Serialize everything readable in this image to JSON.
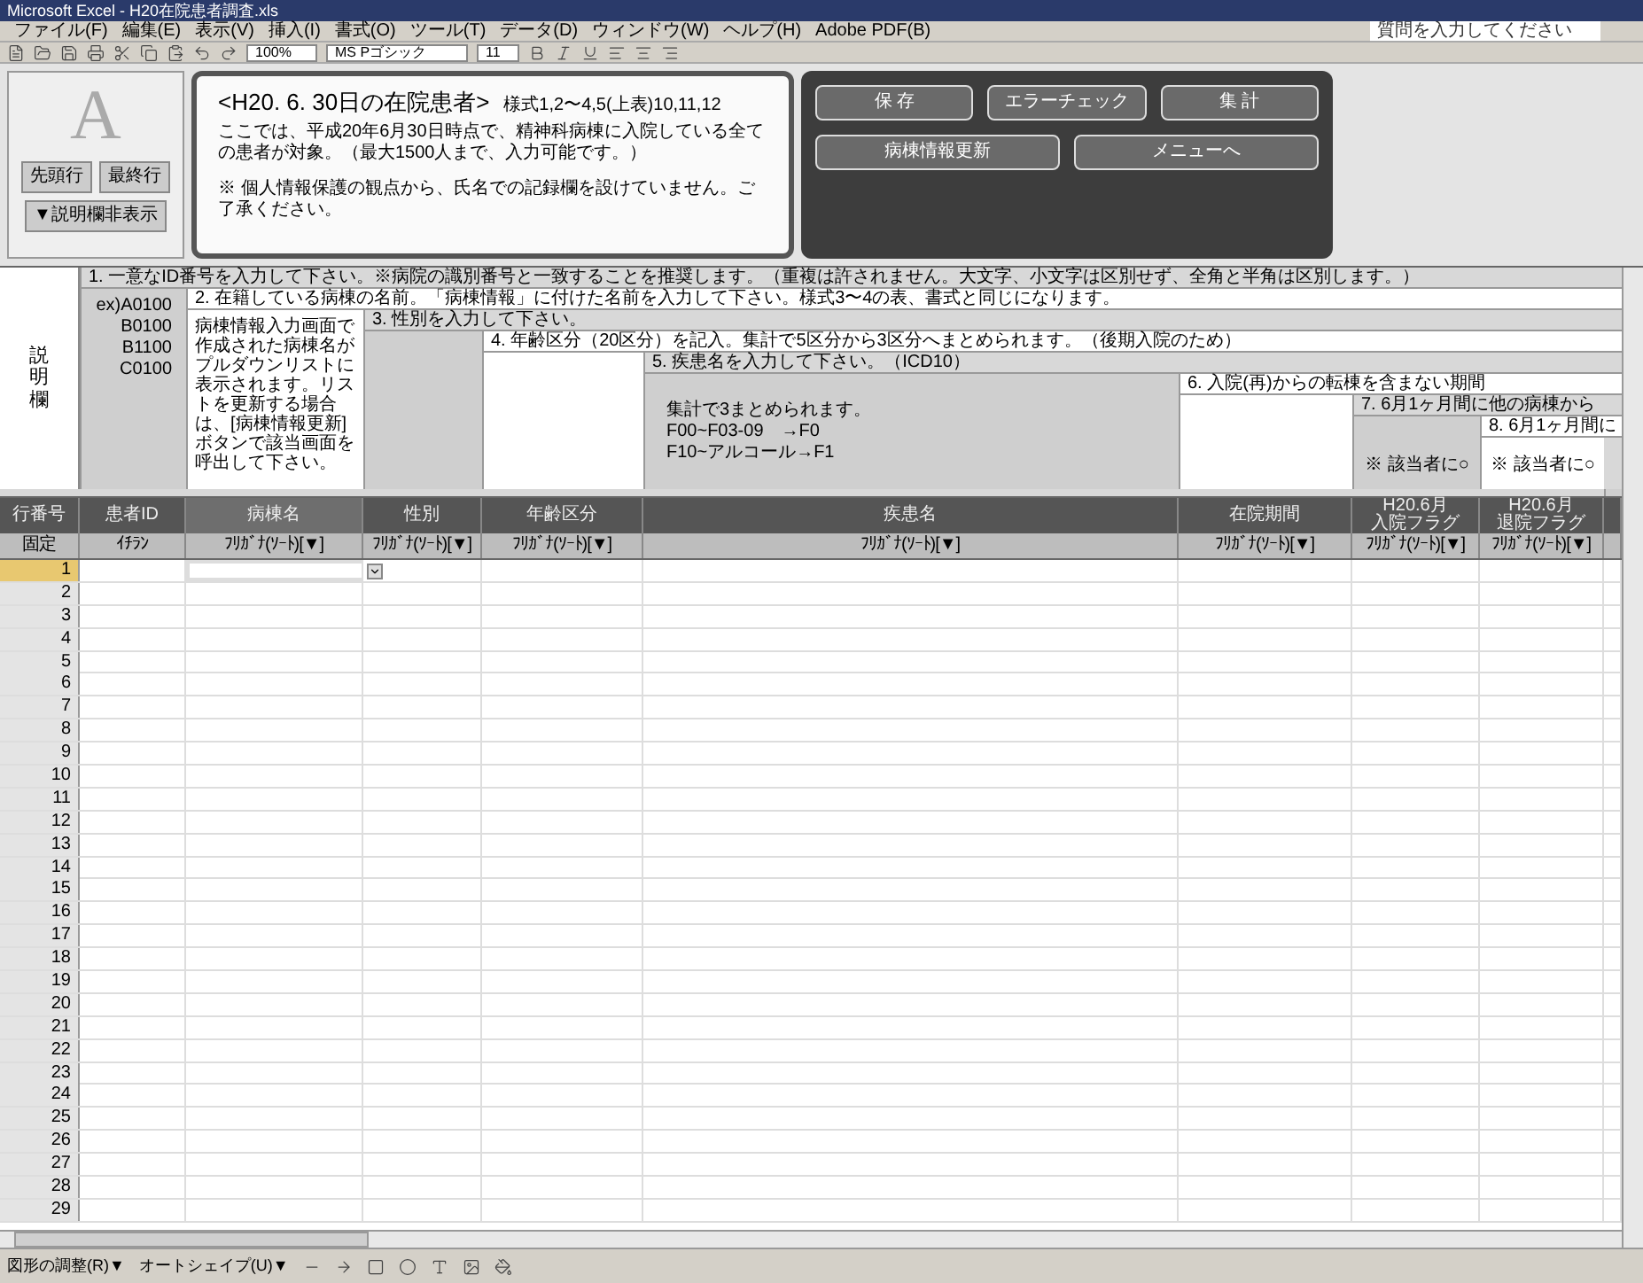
{
  "window": {
    "title": "Microsoft Excel - H20在院患者調査.xls"
  },
  "menu": [
    "ファイル(F)",
    "編集(E)",
    "表示(V)",
    "挿入(I)",
    "書式(O)",
    "ツール(T)",
    "データ(D)",
    "ウィンドウ(W)",
    "ヘルプ(H)",
    "Adobe PDF(B)"
  ],
  "help_search": {
    "placeholder": "質問を入力してください"
  },
  "toolbar": {
    "zoom": "100%",
    "font": "MS Pゴシック",
    "size": "11"
  },
  "logo": {
    "letter": "A"
  },
  "nav_buttons": [
    "先頭行",
    "最終行",
    "▼説明欄非表示"
  ],
  "info": {
    "title": "<H20. 6. 30日の在院患者>",
    "note": "様式1,2〜4,5(上表)10,11,12",
    "body": "ここでは、平成20年6月30日時点で、精神科病棟に入院している全ての患者が対象。（最大1500人まで、入力可能です。）",
    "warning": "※ 個人情報保護の観点から、氏名での記録欄を設けていません。ご了承ください。"
  },
  "action_buttons": [
    [
      "保 存",
      "エラーチェック",
      "集 計"
    ],
    [
      "病棟情報更新",
      "メニューへ"
    ]
  ],
  "description": {
    "label": "説明欄",
    "instructions": [
      {
        "text": "1. 一意なID番号を入力して下さい。※病院の識別番号と一致することを推奨します。（重複は許されません。大文字、小文字は区別せず、全角と半角は区別します。）",
        "shaded": true
      },
      {
        "text": "2. 在籍している病棟の名前。「病棟情報」に付けた名前を入力して下さい。様式3〜4の表、書式と同じになります。",
        "shaded": false
      },
      {
        "text": "3. 性別を入力して下さい。",
        "shaded": true
      },
      {
        "text": "4. 年齢区分（20区分）を記入。集計で5区分から3区分へまとめられます。（後期入院のため）",
        "shaded": false
      },
      {
        "text": "5. 疾患名を入力して下さい。（ICD10）",
        "shaded": true
      },
      {
        "text": "6. 入院(再)からの転棟を含まない期間",
        "shaded": false
      },
      {
        "text": "7. 6月1ヶ月間に他の病棟から",
        "shaded": true
      },
      {
        "text": "8. 6月1ヶ月間に",
        "shaded": false
      }
    ],
    "columns": [
      {
        "lines": [
          "ex)A0100",
          "B0100",
          "B1100",
          "C0100"
        ],
        "shaded": true,
        "kind": "right"
      },
      {
        "lines": [
          "病棟情報入力画面で作成された病棟名がプルダウンリストに表示されます。リストを更新する場合は、[病棟情報更新]ボタンで該当画面を呼出して下さい。"
        ],
        "shaded": false,
        "kind": "center"
      },
      {
        "shaded": true,
        "kind": "center"
      },
      {
        "shaded": false,
        "kind": "center"
      },
      {
        "lines": [
          "集計で3まとめられます。",
          "F00~F03-09　→F0",
          "F10~アルコール→F1"
        ],
        "shaded": true,
        "kind": "middle"
      },
      {
        "shaded": false,
        "kind": "center"
      },
      {
        "lines": [
          "※ 該当者に○"
        ],
        "shaded": true,
        "kind": "bottom"
      },
      {
        "lines": [
          "※ 該当者に○"
        ],
        "shaded": false,
        "kind": "bottom"
      },
      {
        "shaded": true,
        "kind": "center"
      }
    ]
  },
  "table": {
    "columns": [
      {
        "lines": [
          "行番号"
        ],
        "filter": "固定",
        "selected": false
      },
      {
        "lines": [
          "患者ID"
        ],
        "filter": "ｲﾁﾗﾝ",
        "selected": false
      },
      {
        "lines": [
          "病棟名"
        ],
        "filter": "ﾌﾘｶﾞﾅ(ｿｰﾄ)[▼]",
        "selected": true
      },
      {
        "lines": [
          "性別"
        ],
        "filter": "ﾌﾘｶﾞﾅ(ｿｰﾄ)[▼]",
        "selected": false
      },
      {
        "lines": [
          "年齢区分"
        ],
        "filter": "ﾌﾘｶﾞﾅ(ｿｰﾄ)[▼]",
        "selected": false
      },
      {
        "lines": [
          "疾患名"
        ],
        "filter": "ﾌﾘｶﾞﾅ(ｿｰﾄ)[▼]",
        "selected": false
      },
      {
        "lines": [
          "在院期間"
        ],
        "filter": "ﾌﾘｶﾞﾅ(ｿｰﾄ)[▼]",
        "selected": false
      },
      {
        "lines": [
          "H20.6月",
          "入院フラグ"
        ],
        "filter": "ﾌﾘｶﾞﾅ(ｿｰﾄ)[▼]",
        "selected": false
      },
      {
        "lines": [
          "H20.6月",
          "退院フラグ"
        ],
        "filter": "ﾌﾘｶﾞﾅ(ｿｰﾄ)[▼]",
        "selected": false
      },
      {
        "selected": false
      }
    ],
    "rows": [
      {
        "number": "1",
        "selected": true
      },
      {
        "number": "2",
        "selected": false
      },
      {
        "number": "3",
        "selected": false
      },
      {
        "number": "4",
        "selected": false
      },
      {
        "number": "5",
        "selected": false
      },
      {
        "number": "6",
        "selected": false
      },
      {
        "number": "7",
        "selected": false
      },
      {
        "number": "8",
        "selected": false
      },
      {
        "number": "9",
        "selected": false
      },
      {
        "number": "10",
        "selected": false
      },
      {
        "number": "11",
        "selected": false
      },
      {
        "number": "12",
        "selected": false
      },
      {
        "number": "13",
        "selected": false
      },
      {
        "number": "14",
        "selected": false
      },
      {
        "number": "15",
        "selected": false
      },
      {
        "number": "16",
        "selected": false
      },
      {
        "number": "17",
        "selected": false
      },
      {
        "number": "18",
        "selected": false
      },
      {
        "number": "19",
        "selected": false
      },
      {
        "number": "20",
        "selected": false
      },
      {
        "number": "21",
        "selected": false
      },
      {
        "number": "22",
        "selected": false
      },
      {
        "number": "23",
        "selected": false
      },
      {
        "number": "24",
        "selected": false
      },
      {
        "number": "25",
        "selected": false
      },
      {
        "number": "26",
        "selected": false
      },
      {
        "number": "27",
        "selected": false
      },
      {
        "number": "28",
        "selected": false
      },
      {
        "number": "29",
        "selected": false
      }
    ]
  },
  "drawing_toolbar": {
    "draw": "図形の調整(R)▼",
    "autoshape": "オートシェイプ(U)▼"
  }
}
